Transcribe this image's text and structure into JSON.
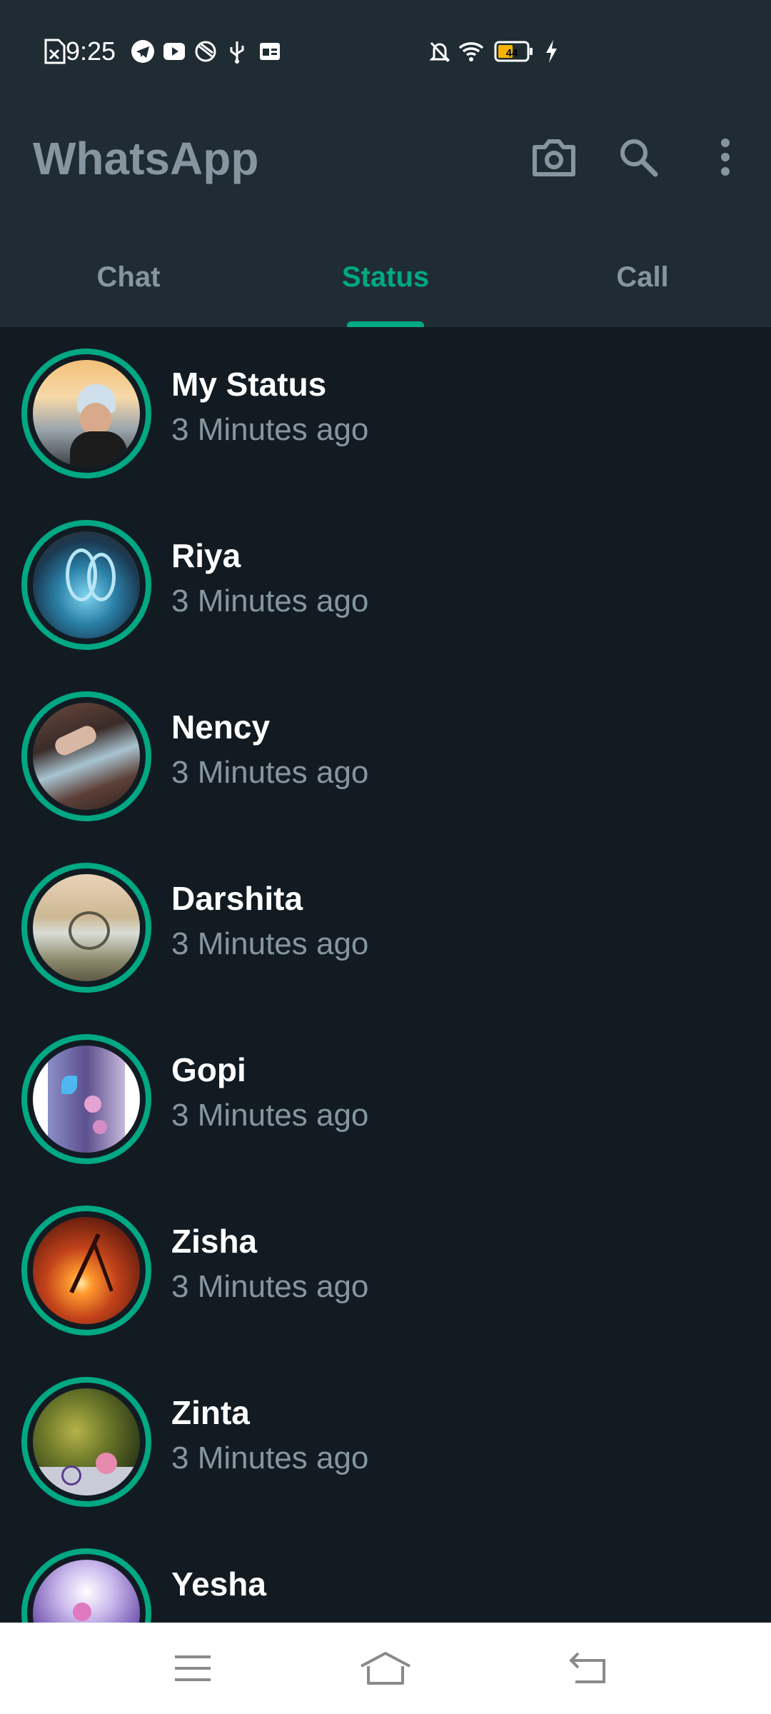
{
  "status_bar": {
    "time": "9:25",
    "battery_level": "44",
    "icons": [
      "sim-error-icon",
      "telegram-icon",
      "youtube-icon",
      "app-icon",
      "usb-icon",
      "news-icon",
      "mute-notifications-icon",
      "wifi-icon",
      "battery-icon",
      "charging-icon"
    ]
  },
  "app_bar": {
    "title": "WhatsApp",
    "icons": [
      "camera-icon",
      "search-icon",
      "more-options-icon"
    ]
  },
  "tabs": [
    {
      "label": "Chat",
      "active": false
    },
    {
      "label": "Status",
      "active": true
    },
    {
      "label": "Call",
      "active": false
    }
  ],
  "colors": {
    "accent": "#00a884",
    "background": "#121b22",
    "header": "#202c33",
    "secondary_text": "#8696a0"
  },
  "statuses": [
    {
      "name": "My Status",
      "time": "3 Minutes ago"
    },
    {
      "name": "Riya",
      "time": "3 Minutes ago"
    },
    {
      "name": "Nency",
      "time": "3 Minutes ago"
    },
    {
      "name": "Darshita",
      "time": "3 Minutes ago"
    },
    {
      "name": "Gopi",
      "time": "3 Minutes ago"
    },
    {
      "name": "Zisha",
      "time": "3 Minutes ago"
    },
    {
      "name": "Zinta",
      "time": "3 Minutes ago"
    },
    {
      "name": "Yesha",
      "time": ""
    }
  ],
  "nav_bar": {
    "icons": [
      "menu-icon",
      "home-icon",
      "back-icon"
    ]
  }
}
